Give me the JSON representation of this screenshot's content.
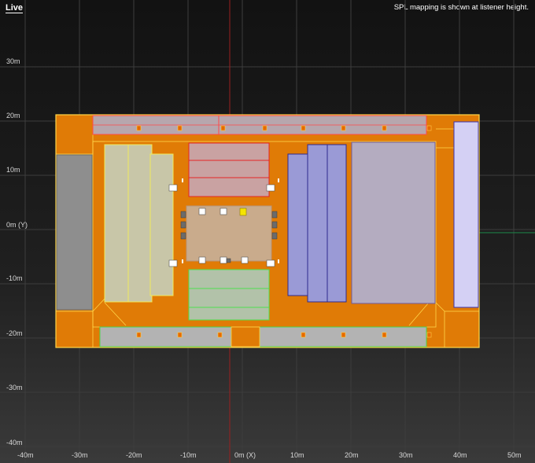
{
  "view": {
    "mode_label": "Live",
    "notice": "SPL mapping is shown at listener height."
  },
  "axes": {
    "x_ticks": [
      "-40m",
      "-30m",
      "-20m",
      "-10m",
      "0m (X)",
      "10m",
      "20m",
      "30m",
      "40m",
      "50m"
    ],
    "y_ticks": [
      "30m",
      "20m",
      "10m",
      "0m (Y)",
      "-10m",
      "-20m",
      "-30m",
      "-40m"
    ]
  },
  "colors": {
    "floor": "#e07b06",
    "outline": "#ffd64a",
    "seating_grey": "#b3b3b3",
    "seating_blue": "#9a9ad6",
    "stage": "#c9ab8c",
    "highlight_speaker": "#f5e400"
  },
  "icons": [
    "speaker-icon",
    "loudspeaker-array-icon"
  ]
}
